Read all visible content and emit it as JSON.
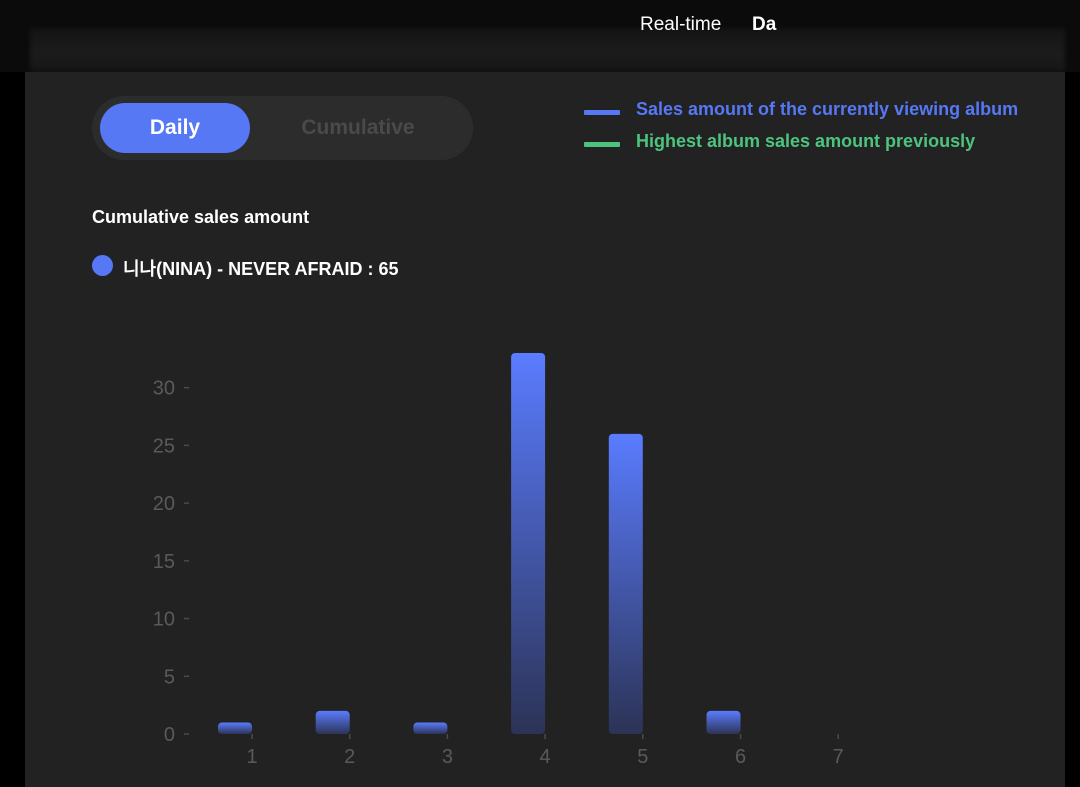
{
  "header": {
    "tabs": [
      {
        "label": "Real-time"
      },
      {
        "label": "Da"
      }
    ]
  },
  "toggle": {
    "options": [
      {
        "label": "Daily",
        "selected": true
      },
      {
        "label": "Cumulative",
        "selected": false
      }
    ]
  },
  "legend": {
    "items": [
      {
        "label": "Sales amount of the currently viewing album",
        "color": "#5678f5"
      },
      {
        "label": "Highest album sales amount previously",
        "color": "#4cc47e"
      }
    ]
  },
  "summary": {
    "title": "Cumulative sales amount",
    "series_label": "니나(NINA) - NEVER AFRAID : 65",
    "dot_color": "#5678f5"
  },
  "chart_data": {
    "type": "bar",
    "categories": [
      "1",
      "2",
      "3",
      "4",
      "5",
      "6",
      "7"
    ],
    "values": [
      1,
      2,
      1,
      33,
      26,
      2,
      0
    ],
    "ylim": [
      0,
      33
    ],
    "yticks": [
      0,
      5,
      10,
      15,
      20,
      25,
      30
    ],
    "grid": false,
    "bar_color_top": "#5a7cff",
    "bar_color_bottom": "#2c3356"
  }
}
